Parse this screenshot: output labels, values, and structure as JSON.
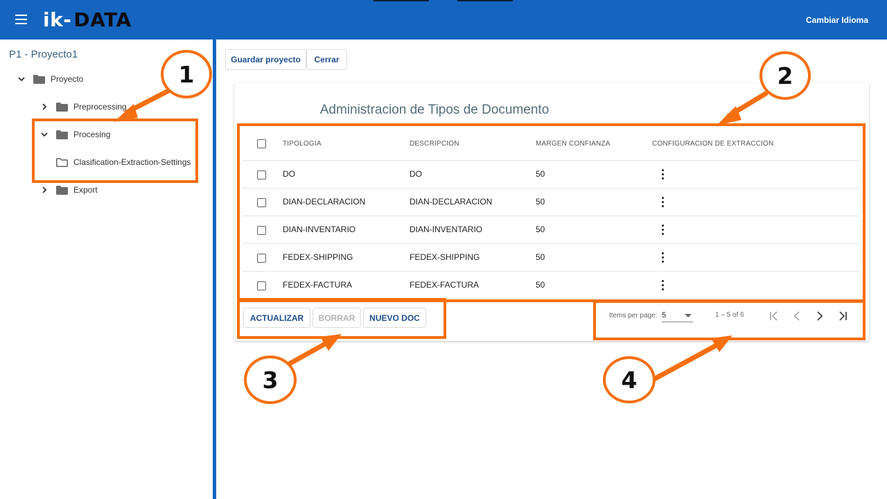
{
  "header": {
    "logo_main": "ik-",
    "logo_sub": "DATA",
    "language_button": "Cambiar Idioma",
    "brand_color": "#1565c0"
  },
  "sidebar": {
    "project_title": "P1 - Proyecto1",
    "tree": [
      {
        "label": "Proyecto",
        "icon": "folder-icon",
        "expanded": true
      },
      {
        "label": "Preprocessing",
        "icon": "folder-icon",
        "expanded": false
      },
      {
        "label": "Procesing",
        "icon": "folder-icon",
        "expanded": true
      },
      {
        "label": "Clasification-Extraction-Settings",
        "icon": "folder-outline-icon"
      },
      {
        "label": "Export",
        "icon": "folder-icon",
        "expanded": false
      }
    ]
  },
  "toolbar": {
    "save_label": "Guardar proyecto",
    "close_label": "Cerrar"
  },
  "card": {
    "title": "Administracion de Tipos de Documento"
  },
  "table": {
    "columns": [
      "TIPOLOGIA",
      "DESCRIPCION",
      "MARGEN CONFIANZA",
      "CONFIGURACION DE EXTRACCION"
    ],
    "rows": [
      {
        "tipologia": "DO",
        "descripcion": "DO",
        "margen": "50"
      },
      {
        "tipologia": "DIAN-DECLARACION",
        "descripcion": "DIAN-DECLARACION",
        "margen": "50"
      },
      {
        "tipologia": "DIAN-INVENTARIO",
        "descripcion": "DIAN-INVENTARIO",
        "margen": "50"
      },
      {
        "tipologia": "FEDEX-SHIPPING",
        "descripcion": "FEDEX-SHIPPING",
        "margen": "50"
      },
      {
        "tipologia": "FEDEX-FACTURA",
        "descripcion": "FEDEX-FACTURA",
        "margen": "50"
      }
    ]
  },
  "actions": {
    "refresh_label": "ACTUALIZAR",
    "delete_label": "BORRAR",
    "new_label": "NUEVO DOC"
  },
  "paginator": {
    "items_per_page_label": "Items per page:",
    "page_size": "5",
    "range_label": "1 – 5 of 6"
  },
  "annotations": {
    "labels": [
      "1",
      "2",
      "3",
      "4"
    ],
    "color": "#f46f0f"
  }
}
